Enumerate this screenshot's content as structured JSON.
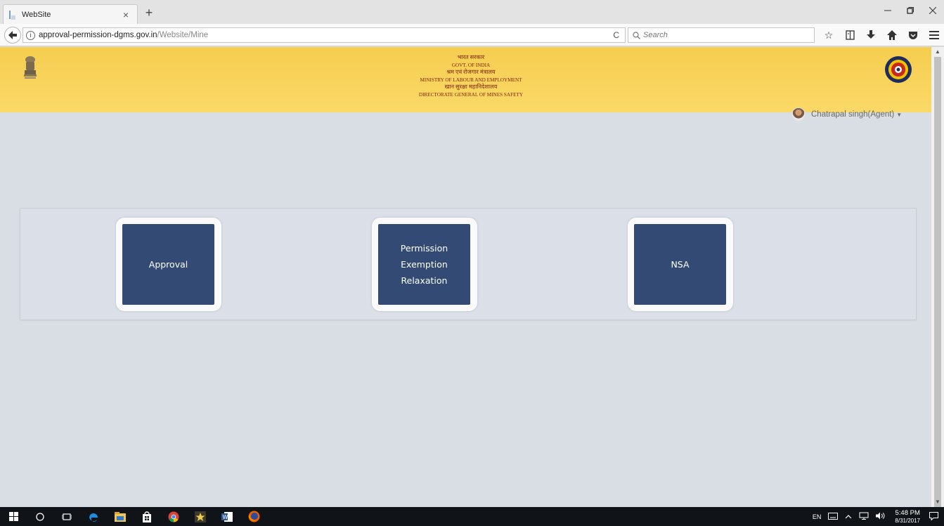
{
  "browser": {
    "tab_title": "WebSite",
    "tab_close": "×",
    "new_tab": "+",
    "url_host": "approval-permission-dgms.gov.in",
    "url_path": "/Website/Mine",
    "search_placeholder": "Search",
    "reload": "C",
    "window_controls": [
      "minimize-icon",
      "restore-icon",
      "close-icon"
    ],
    "toolbar_icons": [
      "bookmark-star-icon",
      "reading-list-icon",
      "download-icon",
      "home-icon",
      "pocket-icon",
      "menu-icon"
    ]
  },
  "header": {
    "lines": [
      "भारत सरकार",
      "GOVT. OF INDIA",
      "श्रम एवं रोजगार मंत्रालय",
      "MINISTRY OF LABOUR AND EMPLOYMENT",
      "खान सुरक्षा महानिदेशालय",
      "DIRECTORATE GENERAL OF MINES SAFETY"
    ],
    "user_name": "Chatrapal singh(Agent)",
    "colors": {
      "header_bg": "#f7d05a",
      "header_text": "#7a1f10"
    }
  },
  "tiles": [
    {
      "label": "Approval"
    },
    {
      "label": "Permission\nExemption\nRelaxation"
    },
    {
      "label": "NSA"
    }
  ],
  "tile_color": "#334b74",
  "taskbar": {
    "icons": [
      "windows-start-icon",
      "cortana-icon",
      "task-view-icon",
      "edge-icon",
      "file-explorer-icon",
      "store-icon",
      "chrome-icon",
      "app-star-icon",
      "word-icon",
      "firefox-icon"
    ],
    "lang": "EN",
    "time": "5:48 PM",
    "date": "8/31/2017"
  }
}
